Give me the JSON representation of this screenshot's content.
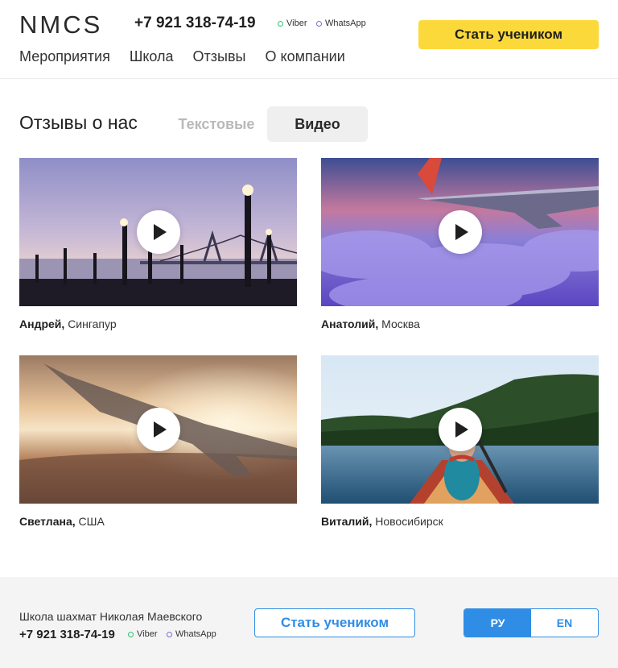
{
  "header": {
    "logo": "NMCS",
    "phone": "+7 921 318-74-19",
    "viber": "Viber",
    "whatsapp": "WhatsApp",
    "cta": "Стать учеником",
    "nav": [
      "Мероприятия",
      "Школа",
      "Отзывы",
      "О компании"
    ]
  },
  "section": {
    "title": "Отзывы о нас",
    "tabs": {
      "text": "Текстовые",
      "video": "Видео"
    },
    "active_tab": "video"
  },
  "reviews": [
    {
      "name": "Андрей,",
      "city": "Сингапур",
      "scene": "pier-bridge-sunset"
    },
    {
      "name": "Анатолий,",
      "city": "Москва",
      "scene": "wing-over-clouds"
    },
    {
      "name": "Светлана,",
      "city": "США",
      "scene": "wing-golden-sunset"
    },
    {
      "name": "Виталий,",
      "city": "Новосибирск",
      "scene": "canoe-lake"
    }
  ],
  "footer": {
    "school": "Школа шахмат Николая Маевского",
    "phone": "+7 921 318-74-19",
    "viber": "Viber",
    "whatsapp": "WhatsApp",
    "cta": "Стать учеником",
    "lang": {
      "ru": "РУ",
      "en": "EN",
      "active": "ru"
    }
  },
  "colors": {
    "accent_yellow": "#fcd93b",
    "accent_blue": "#2f8de6",
    "viber_dot": "#2fc56f",
    "whatsapp_dot": "#7b6cd9"
  },
  "icons": [
    "play-icon",
    "viber-status-icon",
    "whatsapp-status-icon"
  ]
}
